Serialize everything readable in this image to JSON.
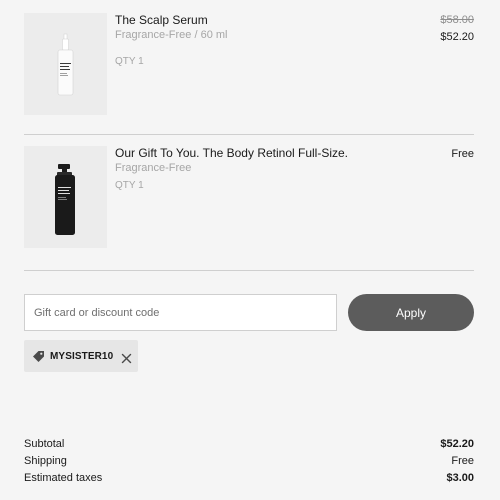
{
  "cart": {
    "items": [
      {
        "title": "The Scalp Serum",
        "variant": "Fragrance-Free / 60 ml",
        "qty": "QTY 1",
        "price_original": "$58.00",
        "price": "$52.20",
        "image_icon": "serum-dropper-bottle"
      },
      {
        "title": "Our Gift To You. The Body Retinol Full-Size.",
        "variant": "Fragrance-Free",
        "qty": "QTY 1",
        "price": "Free",
        "image_icon": "black-pump-bottle"
      }
    ]
  },
  "discount": {
    "placeholder": "Gift card or discount code",
    "value": "",
    "apply_label": "Apply",
    "applied_code": "MYSISTER10",
    "tag_icon": "tag-icon",
    "remove_icon": "close-icon"
  },
  "summary": {
    "subtotal_label": "Subtotal",
    "subtotal_value": "$52.20",
    "shipping_label": "Shipping",
    "shipping_value": "Free",
    "taxes_label": "Estimated taxes",
    "taxes_value": "$3.00"
  },
  "colors": {
    "background": "#f5f5f5",
    "apply_button": "#5c5c5c",
    "muted_text": "#a6a6a6",
    "tag_bg": "#e6e6e6"
  }
}
